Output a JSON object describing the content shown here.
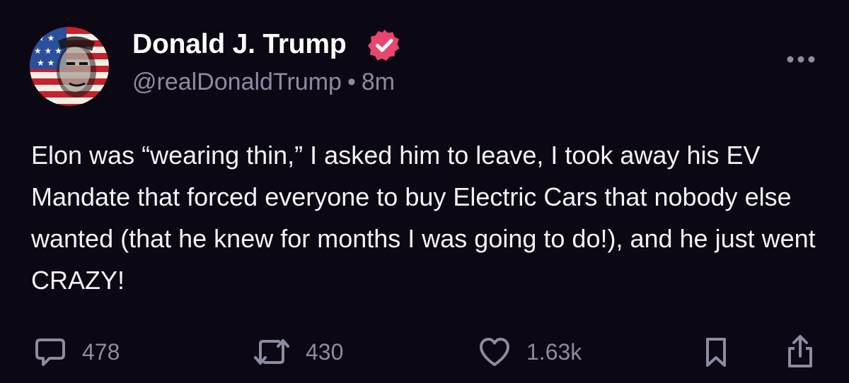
{
  "author": {
    "display_name": "Donald J. Trump",
    "handle": "@realDonaldTrump",
    "separator": "•",
    "timestamp": "8m",
    "verified": true
  },
  "post": {
    "text": "Elon was “wearing thin,” I asked him to leave, I took away his EV Mandate that forced everyone to buy Electric Cars that nobody else wanted (that he knew for months I was going to do!), and he just went CRAZY!"
  },
  "actions": {
    "replies": "478",
    "reposts": "430",
    "likes": "1.63k"
  },
  "colors": {
    "background": "#0b0713",
    "text": "#f4f3f7",
    "muted": "#8e8aa0",
    "verified": "#e8466e"
  },
  "icons": [
    "more-icon",
    "reply-icon",
    "repost-icon",
    "heart-icon",
    "bookmark-icon",
    "share-icon",
    "verified-badge-icon"
  ]
}
